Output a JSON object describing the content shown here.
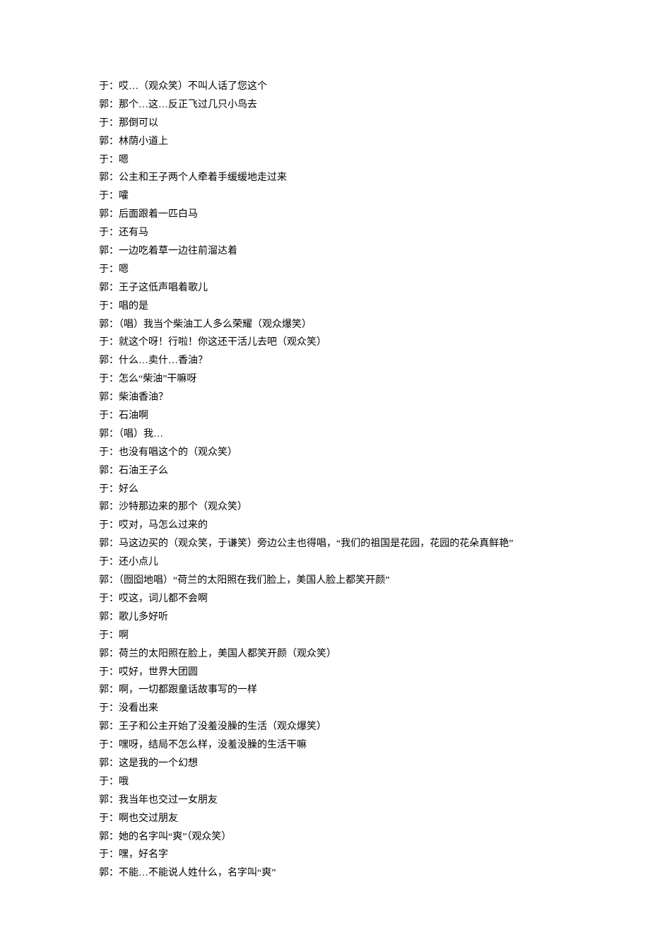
{
  "lines": [
    {
      "speaker": "于",
      "text": "哎…（观众笑）不叫人话了您这个"
    },
    {
      "speaker": "郭",
      "text": "那个…这…反正飞过几只小鸟去"
    },
    {
      "speaker": "于",
      "text": "那倒可以"
    },
    {
      "speaker": "郭",
      "text": "林荫小道上"
    },
    {
      "speaker": "于",
      "text": "嗯"
    },
    {
      "speaker": "郭",
      "text": "公主和王子两个人牵着手缓缓地走过来"
    },
    {
      "speaker": "于",
      "text": "嚯"
    },
    {
      "speaker": "郭",
      "text": "后面跟着一匹白马"
    },
    {
      "speaker": "于",
      "text": "还有马"
    },
    {
      "speaker": "郭",
      "text": "一边吃着草一边往前溜达着"
    },
    {
      "speaker": "于",
      "text": "嗯"
    },
    {
      "speaker": "郭",
      "text": "王子这低声唱着歌儿"
    },
    {
      "speaker": "于",
      "text": "唱的是"
    },
    {
      "speaker": "郭",
      "text": "（唱）我当个柴油工人多么荣耀（观众爆笑）"
    },
    {
      "speaker": "于",
      "text": "就这个呀！行啦！你这还干活儿去吧（观众笑）"
    },
    {
      "speaker": "郭",
      "text": "什么…卖什…香油？"
    },
    {
      "speaker": "于",
      "text": "怎么“柴油”干嘛呀"
    },
    {
      "speaker": "郭",
      "text": "柴油香油？"
    },
    {
      "speaker": "于",
      "text": "石油啊"
    },
    {
      "speaker": "郭",
      "text": "（唱）我…"
    },
    {
      "speaker": "于",
      "text": "也没有唱这个的（观众笑）"
    },
    {
      "speaker": "郭",
      "text": "石油王子么"
    },
    {
      "speaker": "于",
      "text": "好么"
    },
    {
      "speaker": "郭",
      "text": "沙特那边来的那个（观众笑）"
    },
    {
      "speaker": "于",
      "text": "哎对，马怎么过来的"
    },
    {
      "speaker": "郭",
      "text": "马这边买的（观众笑，于谦笑）旁边公主也得唱，“我们的祖国是花园，花园的花朵真鲜艳”"
    },
    {
      "speaker": "于",
      "text": "还小点儿"
    },
    {
      "speaker": "郭",
      "text": "（囫囵地唱）“荷兰的太阳照在我们脸上，美国人脸上都笑开颜”"
    },
    {
      "speaker": "于",
      "text": "哎这，词儿都不会啊"
    },
    {
      "speaker": "郭",
      "text": "歌儿多好听"
    },
    {
      "speaker": "于",
      "text": "啊"
    },
    {
      "speaker": "郭",
      "text": "荷兰的太阳照在脸上，美国人都笑开颜（观众笑）"
    },
    {
      "speaker": "于",
      "text": "哎好，世界大团圆"
    },
    {
      "speaker": "郭",
      "text": "啊，一切都跟童话故事写的一样"
    },
    {
      "speaker": "于",
      "text": "没看出来"
    },
    {
      "speaker": "郭",
      "text": "王子和公主开始了没羞没臊的生活（观众爆笑）"
    },
    {
      "speaker": "于",
      "text": "嘿呀，结局不怎么样，没羞没臊的生活干嘛"
    },
    {
      "speaker": "郭",
      "text": "这是我的一个幻想"
    },
    {
      "speaker": "于",
      "text": "哦"
    },
    {
      "speaker": "郭",
      "text": "我当年也交过一女朋友"
    },
    {
      "speaker": "于",
      "text": "啊也交过朋友"
    },
    {
      "speaker": "郭",
      "text": "她的名字叫“爽”（观众笑）"
    },
    {
      "speaker": "于",
      "text": "嘿，好名字"
    },
    {
      "speaker": "郭",
      "text": "不能…不能说人姓什么，名字叫“爽”"
    }
  ]
}
